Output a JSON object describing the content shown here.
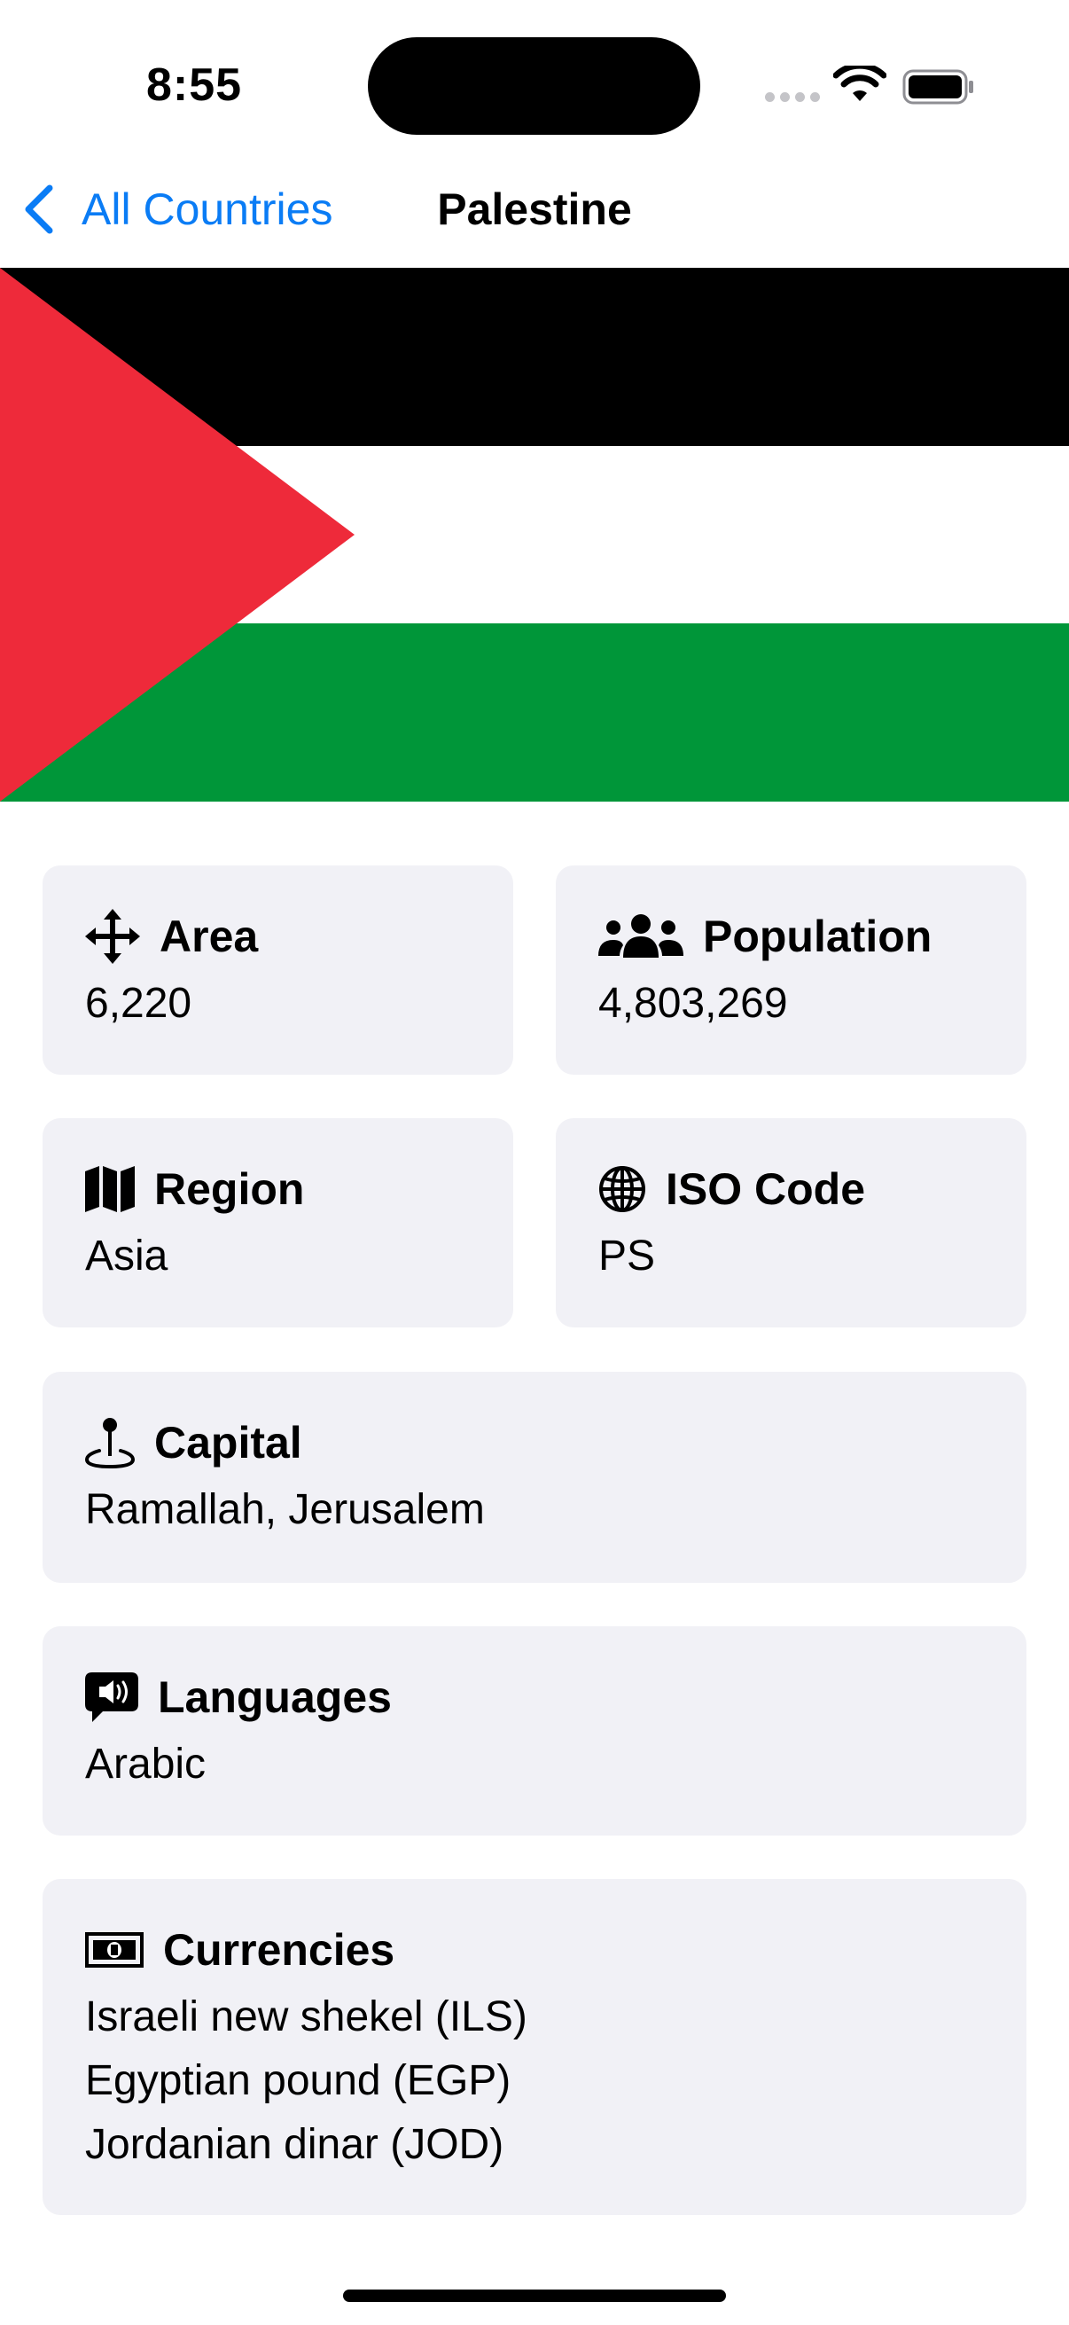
{
  "status_bar": {
    "time": "8:55",
    "icons": [
      "cellular-signal-icon",
      "wifi-icon",
      "battery-icon"
    ]
  },
  "nav": {
    "back_label": "All Countries",
    "title": "Palestine",
    "accent_color": "#0a7cf5"
  },
  "flag": {
    "country": "Palestine",
    "colors": {
      "top": "#000000",
      "middle": "#ffffff",
      "bottom": "#009639",
      "triangle": "#ee2a3a"
    }
  },
  "details": {
    "area": {
      "icon": "move-arrows-icon",
      "label": "Area",
      "value": "6,220"
    },
    "population": {
      "icon": "people-icon",
      "label": "Population",
      "value": "4,803,269"
    },
    "region": {
      "icon": "map-icon",
      "label": "Region",
      "value": "Asia"
    },
    "iso_code": {
      "icon": "globe-icon",
      "label": "ISO Code",
      "value": "PS"
    },
    "capital": {
      "icon": "pin-icon",
      "label": "Capital",
      "value": "Ramallah, Jerusalem"
    },
    "languages": {
      "icon": "speech-bubble-speaker-icon",
      "label": "Languages",
      "value": "Arabic"
    },
    "currencies": {
      "icon": "banknote-icon",
      "label": "Currencies",
      "values": [
        "Israeli new shekel (ILS)",
        "Egyptian pound (EGP)",
        "Jordanian dinar (JOD)"
      ]
    }
  },
  "card_background": "#f1f1f6"
}
